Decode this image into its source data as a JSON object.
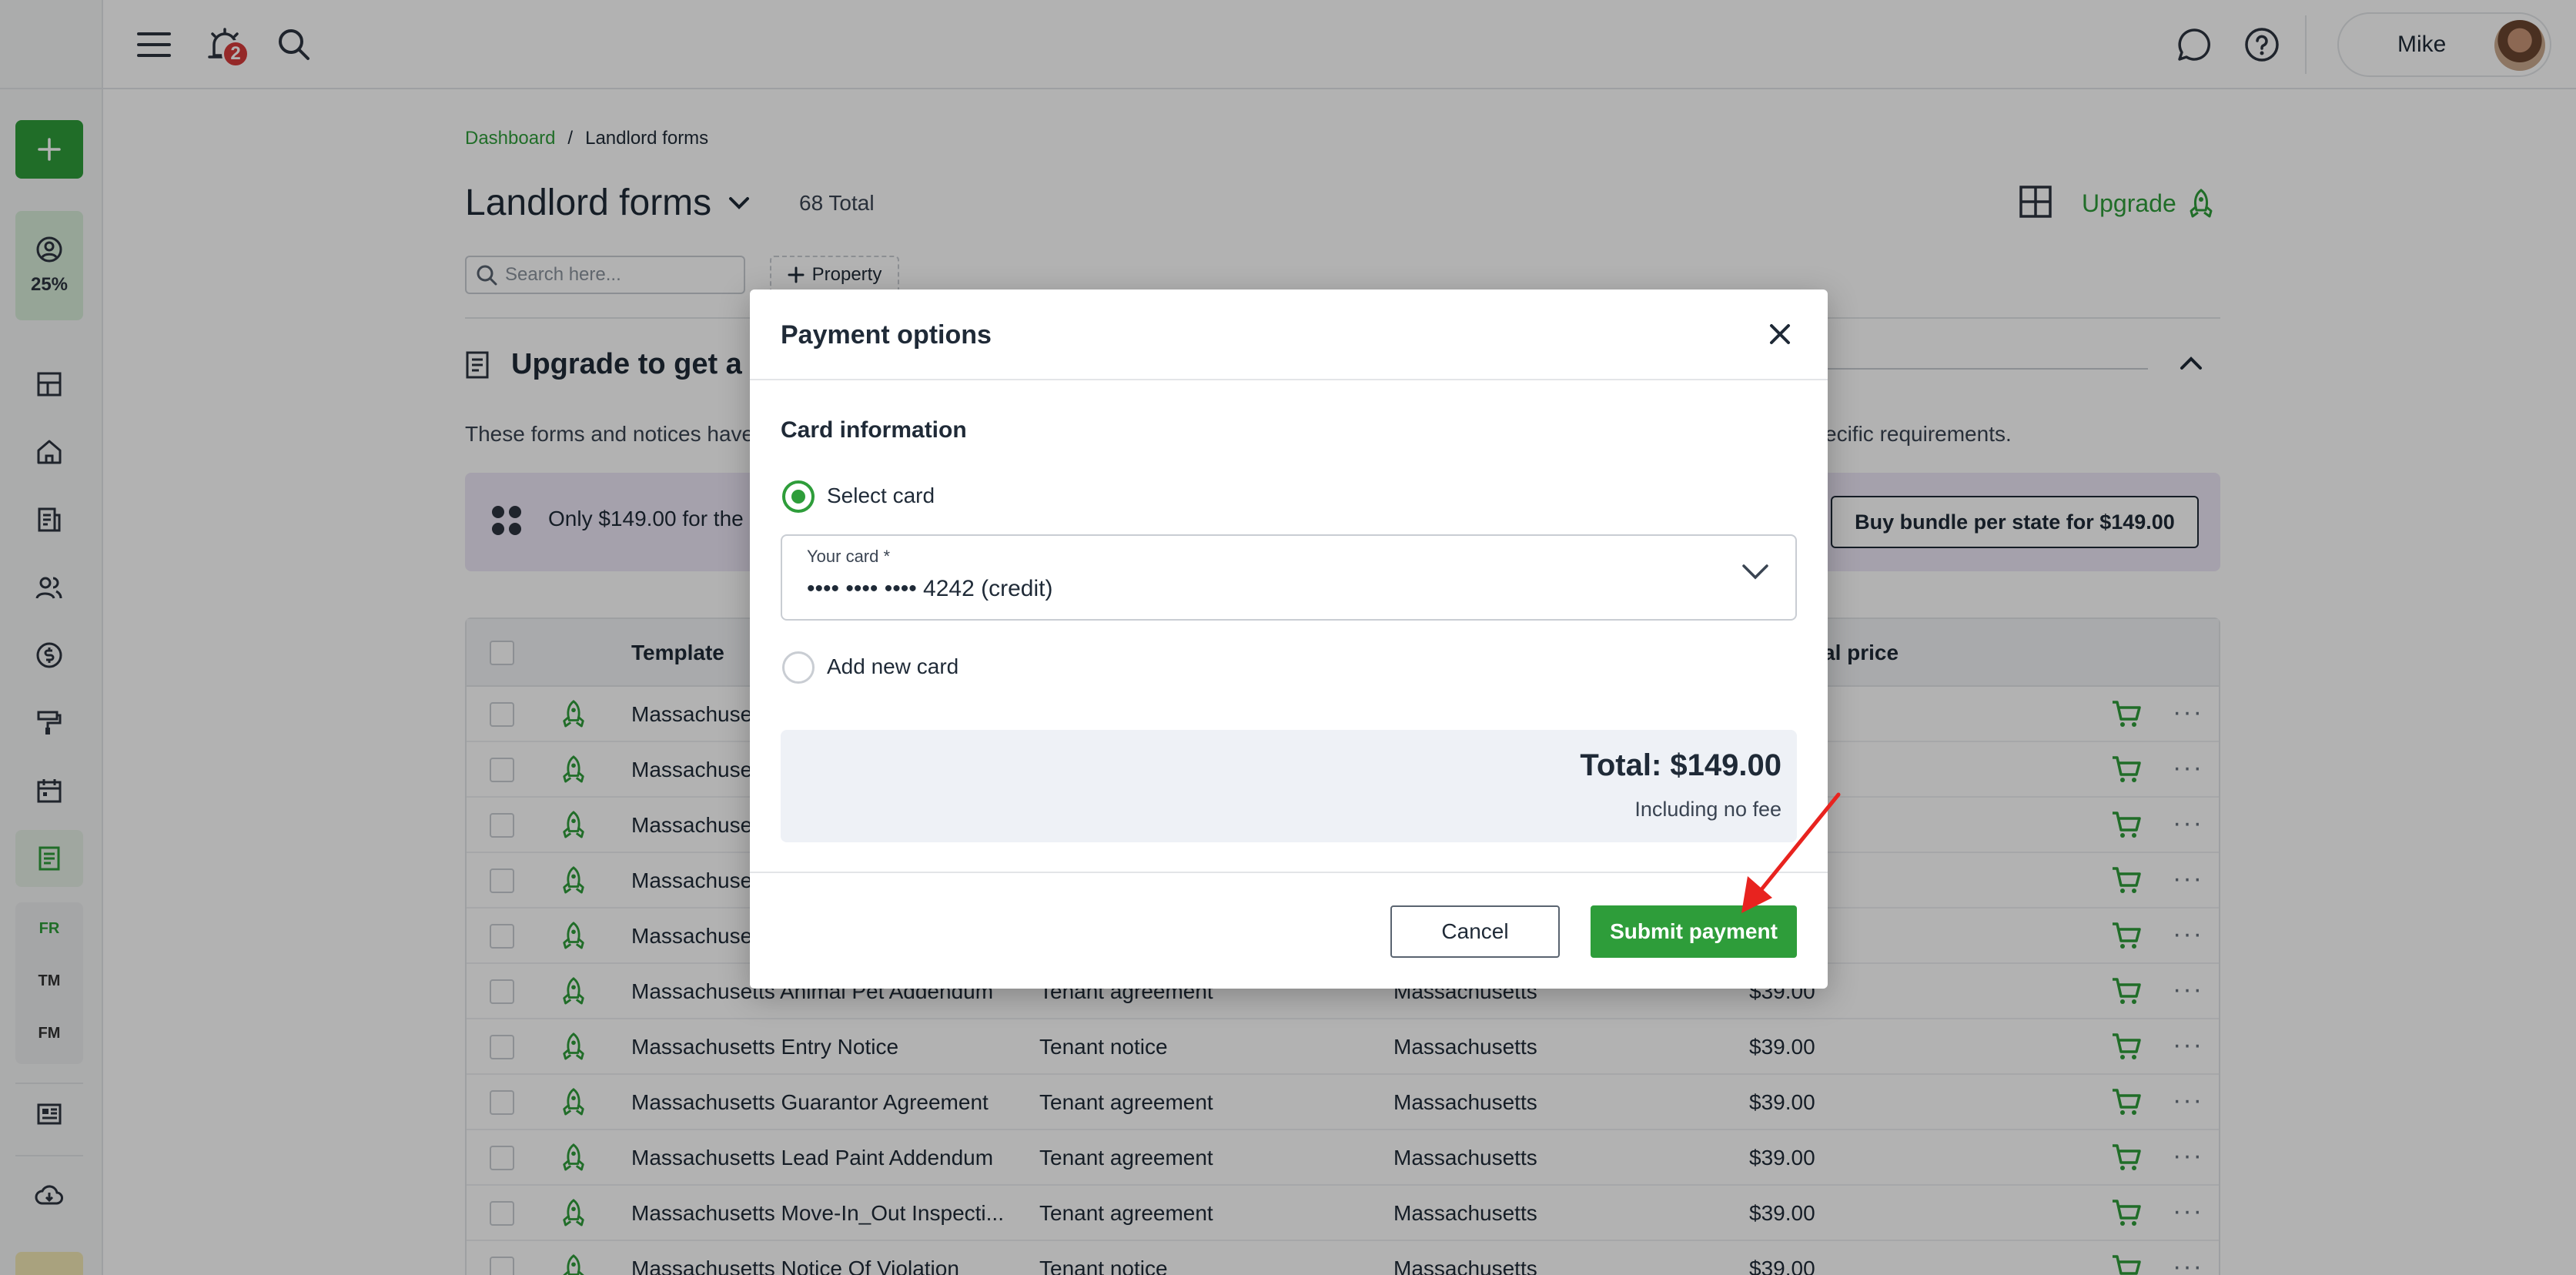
{
  "header": {
    "notification_count": "2",
    "user_name": "Mike"
  },
  "sidebar": {
    "progress": "25%",
    "text_items": [
      "FR",
      "TM",
      "FM"
    ]
  },
  "breadcrumb": {
    "root": "Dashboard",
    "separator": "/",
    "current": "Landlord forms"
  },
  "page": {
    "title": "Landlord forms",
    "total": "68 Total",
    "upgrade_label": "Upgrade",
    "search_placeholder": "Search here...",
    "property_filter": "Property"
  },
  "upgrade_section": {
    "heading": "Upgrade to get a",
    "description": "These forms and notices have",
    "description_tail": "ecific requirements.",
    "bundle_text": "Only $149.00 for the L",
    "bundle_button": "Buy bundle per state for $149.00"
  },
  "table": {
    "headers": {
      "template": "Template",
      "price": "al price"
    },
    "rows": [
      {
        "template": "Massachuset",
        "type": "",
        "state": "",
        "price": ""
      },
      {
        "template": "Massachuset",
        "type": "",
        "state": "",
        "price": ""
      },
      {
        "template": "Massachuset",
        "type": "",
        "state": "",
        "price": ""
      },
      {
        "template": "Massachuset",
        "type": "",
        "state": "",
        "price": ""
      },
      {
        "template": "Massachuset",
        "type": "",
        "state": "",
        "price": ""
      },
      {
        "template": "Massachusetts Animal Pet Addendum",
        "type": "Tenant agreement",
        "state": "Massachusetts",
        "price": "$39.00"
      },
      {
        "template": "Massachusetts Entry Notice",
        "type": "Tenant notice",
        "state": "Massachusetts",
        "price": "$39.00"
      },
      {
        "template": "Massachusetts Guarantor Agreement",
        "type": "Tenant agreement",
        "state": "Massachusetts",
        "price": "$39.00"
      },
      {
        "template": "Massachusetts Lead Paint Addendum",
        "type": "Tenant agreement",
        "state": "Massachusetts",
        "price": "$39.00"
      },
      {
        "template": "Massachusetts Move-In_Out Inspecti...",
        "type": "Tenant agreement",
        "state": "Massachusetts",
        "price": "$39.00"
      },
      {
        "template": "Massachusetts Notice Of Violation",
        "type": "Tenant notice",
        "state": "Massachusetts",
        "price": "$39.00"
      }
    ]
  },
  "modal": {
    "title": "Payment options",
    "section": "Card information",
    "option_select_card": "Select card",
    "card_field_label": "Your card *",
    "card_field_value": "•••• •••• •••• 4242 (credit)",
    "option_add_card": "Add new card",
    "total": "Total: $149.00",
    "total_note": "Including no fee",
    "cancel_label": "Cancel",
    "submit_label": "Submit payment"
  },
  "colors": {
    "accent": "#2e9d3a",
    "annotation_arrow": "#e8231f"
  }
}
